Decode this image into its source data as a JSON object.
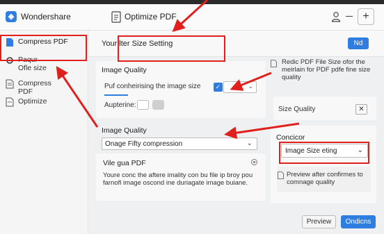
{
  "header": {
    "logo_glyph": "◈",
    "app_name": "Wondershare",
    "title": "Optimize PDF",
    "plus_label": "+"
  },
  "sidebar": {
    "items": [
      {
        "label": "Compress PDF",
        "icon": "file-blue-icon"
      },
      {
        "label": "Paqur\nOfle size",
        "icon": "settings-icon"
      },
      {
        "label": "Compress\nPDF",
        "icon": "file-icon"
      },
      {
        "label": "Optimize",
        "icon": "doc-icon"
      }
    ]
  },
  "main": {
    "title": "Your lter Size Setting",
    "nd_button": "Nd",
    "image_quality_1": {
      "heading": "Image Quality",
      "row_text": "Puf conheirising the image size",
      "check_glyph": "✓",
      "auperine": "Aupterine:"
    },
    "image_quality_2": {
      "heading": "Image Quality",
      "select_value": "Onage Fifty compression"
    },
    "vile": {
      "heading": "Vile gua PDF",
      "description": "Youre conc the aftere imality con bu file ip broy pou farnofl image oscond ine duriagate image buiane."
    }
  },
  "right": {
    "info_text": "Redic PDF File Size ofor the meirlain for PDF pdfe fine size quality",
    "size_quality_label": "Size Quality",
    "close_glyph": "✕",
    "concicor": {
      "heading": "Concicor",
      "select_value": "Image Size eting"
    },
    "preview_text": "Preview after confirmes to comnage quality"
  },
  "footer": {
    "preview_button": "Preview",
    "confirm_button": "Ondicns"
  },
  "colors": {
    "accent": "#2f7de1",
    "annotation_red": "#e0201d"
  }
}
